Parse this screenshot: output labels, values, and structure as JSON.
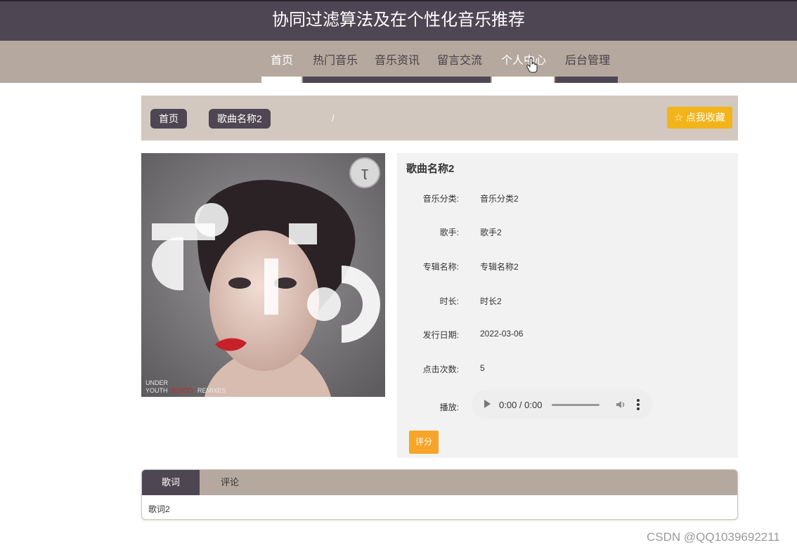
{
  "header": {
    "title": "协同过滤算法及在个性化音乐推荐"
  },
  "nav": {
    "items": [
      {
        "label": "首页"
      },
      {
        "label": "热门音乐"
      },
      {
        "label": "音乐资讯"
      },
      {
        "label": "留言交流"
      },
      {
        "label": "个人中心"
      },
      {
        "label": "后台管理"
      }
    ]
  },
  "breadcrumb": {
    "home": "首页",
    "separator": "/",
    "current": "歌曲名称2"
  },
  "favorite_button": {
    "label": "☆ 点我收藏"
  },
  "cover": {
    "text_line1": "UNDER",
    "text_line2": "YOUTH",
    "text_red": "BLOOD",
    "text_after": "REMIXES"
  },
  "song": {
    "title": "歌曲名称2",
    "fields": [
      {
        "label": "音乐分类:",
        "value": "音乐分类2"
      },
      {
        "label": "歌手:",
        "value": "歌手2"
      },
      {
        "label": "专辑名称:",
        "value": "专辑名称2"
      },
      {
        "label": "时长:",
        "value": "时长2"
      },
      {
        "label": "发行日期:",
        "value": "2022-03-06"
      },
      {
        "label": "点击次数:",
        "value": "5"
      }
    ],
    "play_label": "播放:",
    "audio_time": "0:00 / 0:00",
    "rate_button": "评分"
  },
  "tabs": {
    "items": [
      {
        "label": "歌词"
      },
      {
        "label": "评论"
      }
    ],
    "active": "歌词",
    "content": "歌词2"
  },
  "watermark": "CSDN @QQ1039692211",
  "colors": {
    "header_bg": "#4f4653",
    "nav_bg": "#b5a89e",
    "favorite": "#f3b41a",
    "rate": "#f7a428"
  }
}
